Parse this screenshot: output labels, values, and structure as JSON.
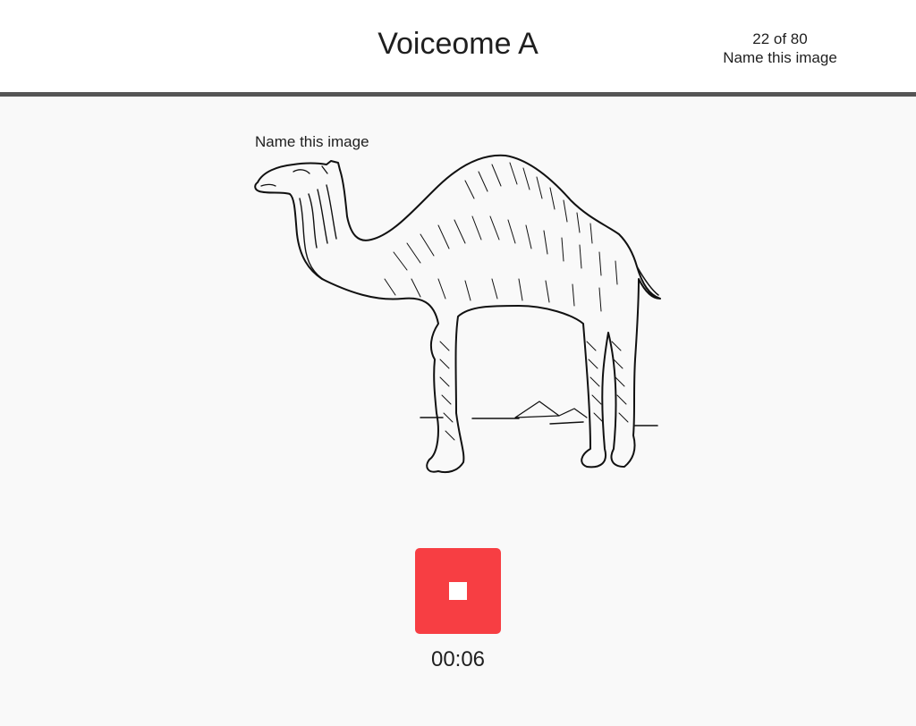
{
  "header": {
    "title": "Voiceome A",
    "progress_count": "22 of 80",
    "progress_task": "Name this image"
  },
  "task": {
    "prompt": "Name this image",
    "image_subject": "camel-drawing"
  },
  "recorder": {
    "state": "recording",
    "button_icon": "stop-icon",
    "button_color": "#f73e43",
    "elapsed": "00:06"
  }
}
